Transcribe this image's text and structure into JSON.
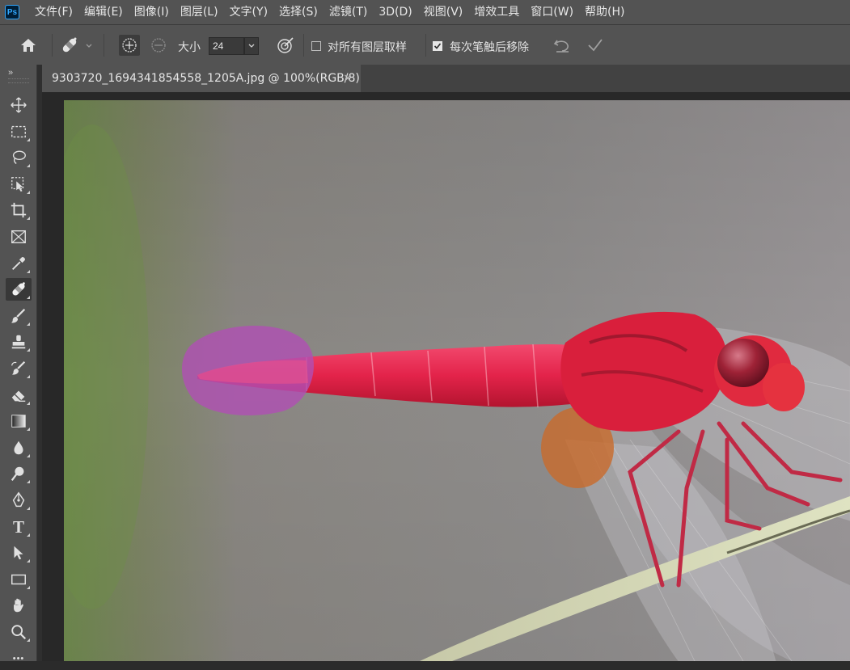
{
  "app": {
    "logo_text": "Ps",
    "accent": "#31a8ff"
  },
  "menu": [
    "文件(F)",
    "编辑(E)",
    "图像(I)",
    "图层(L)",
    "文字(Y)",
    "选择(S)",
    "滤镜(T)",
    "3D(D)",
    "视图(V)",
    "增效工具",
    "窗口(W)",
    "帮助(H)"
  ],
  "options": {
    "size_label": "大小",
    "size_value": "24",
    "sample_all_layers_label": "对所有图层取样",
    "sample_all_layers_checked": false,
    "remove_after_stroke_label": "每次笔触后移除",
    "remove_after_stroke_checked": true
  },
  "document": {
    "tab_title": "9303720_1694341854558_1205A.jpg @ 100%(RGB/8)",
    "close_glyph": "×"
  },
  "tools": [
    {
      "name": "move-tool",
      "icon": "move-icon",
      "active": false
    },
    {
      "name": "marquee-tool",
      "icon": "marquee-icon",
      "active": false
    },
    {
      "name": "lasso-tool",
      "icon": "lasso-icon",
      "active": false
    },
    {
      "name": "object-selection-tool",
      "icon": "object-selection-icon",
      "active": false
    },
    {
      "name": "crop-tool",
      "icon": "crop-icon",
      "active": false
    },
    {
      "name": "frame-tool",
      "icon": "frame-icon",
      "active": false
    },
    {
      "name": "eyedropper-tool",
      "icon": "eyedropper-icon",
      "active": false
    },
    {
      "name": "healing-brush-tool",
      "icon": "bandage-icon",
      "active": true
    },
    {
      "name": "brush-tool",
      "icon": "brush-icon",
      "active": false
    },
    {
      "name": "clone-stamp-tool",
      "icon": "stamp-icon",
      "active": false
    },
    {
      "name": "history-brush-tool",
      "icon": "history-brush-icon",
      "active": false
    },
    {
      "name": "eraser-tool",
      "icon": "eraser-icon",
      "active": false
    },
    {
      "name": "gradient-tool",
      "icon": "gradient-icon",
      "active": false
    },
    {
      "name": "blur-tool",
      "icon": "drop-icon",
      "active": false
    },
    {
      "name": "dodge-tool",
      "icon": "dodge-icon",
      "active": false
    },
    {
      "name": "pen-tool",
      "icon": "pen-icon",
      "active": false
    },
    {
      "name": "type-tool",
      "icon": "type-icon",
      "active": false
    },
    {
      "name": "path-selection-tool",
      "icon": "arrow-icon",
      "active": false
    },
    {
      "name": "rectangle-tool",
      "icon": "rectangle-icon",
      "active": false
    },
    {
      "name": "hand-tool",
      "icon": "hand-icon",
      "active": false
    },
    {
      "name": "zoom-tool",
      "icon": "zoom-icon",
      "active": false
    },
    {
      "name": "more-tools",
      "icon": "more-icon",
      "active": false
    }
  ],
  "tool_glyphs": {
    "type": "T",
    "more": "•••"
  }
}
